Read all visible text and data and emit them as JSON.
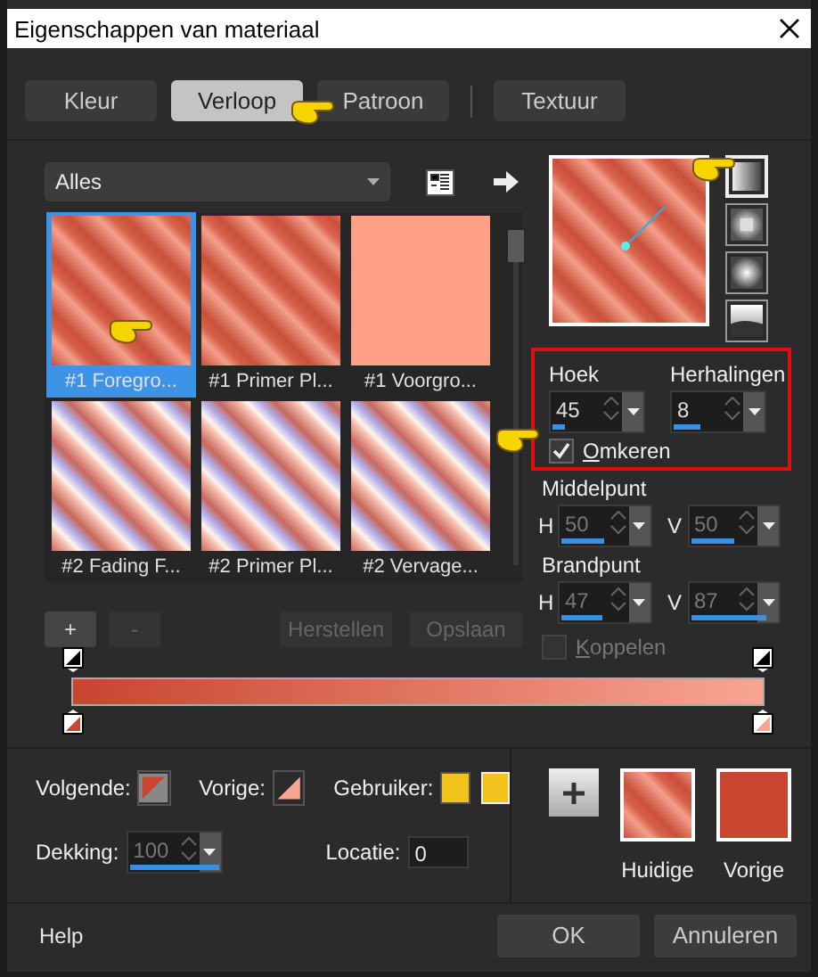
{
  "window": {
    "title": "Eigenschappen van materiaal"
  },
  "tabs": [
    {
      "label": "Kleur",
      "selected": false
    },
    {
      "label": "Verloop",
      "selected": true
    },
    {
      "label": "Patroon",
      "selected": false
    },
    {
      "label": "Textuur",
      "selected": false
    }
  ],
  "category": {
    "value": "Alles"
  },
  "gradients": [
    {
      "label": "#1 Foregro...",
      "selected": true,
      "kind": "stripes"
    },
    {
      "label": "#1 Primer Pl...",
      "selected": false,
      "kind": "stripes"
    },
    {
      "label": "#1 Voorgro...",
      "selected": false,
      "kind": "solid"
    },
    {
      "label": "#2 Fading F...",
      "selected": false,
      "kind": "checker"
    },
    {
      "label": "#2 Primer Pl...",
      "selected": false,
      "kind": "checker"
    },
    {
      "label": "#2 Vervage...",
      "selected": false,
      "kind": "checker"
    }
  ],
  "stop_buttons": [
    {
      "label": "+",
      "disabled": false
    },
    {
      "label": "-",
      "disabled": true
    }
  ],
  "preset_buttons": [
    {
      "label": "Herstellen",
      "disabled": true
    },
    {
      "label": "Opslaan",
      "disabled": true
    }
  ],
  "styles": [
    {
      "kind": "linear",
      "selected": true
    },
    {
      "kind": "rectangular",
      "selected": false
    },
    {
      "kind": "sunburst",
      "selected": false
    },
    {
      "kind": "radial",
      "selected": false
    }
  ],
  "angle": {
    "label": "Hoek",
    "value": "45",
    "level": 0.13
  },
  "repeats": {
    "label": "Herhalingen",
    "value": "8",
    "level": 0.3
  },
  "invert": {
    "label": "Omkeren",
    "checked": true
  },
  "center": {
    "label": "Middelpunt",
    "h": {
      "label": "H",
      "value": "50",
      "level": 0.5,
      "disabled": true
    },
    "v": {
      "label": "V",
      "value": "50",
      "level": 0.5,
      "disabled": true
    }
  },
  "focus": {
    "label": "Brandpunt",
    "h": {
      "label": "H",
      "value": "47",
      "level": 0.47,
      "disabled": true
    },
    "v": {
      "label": "V",
      "value": "87",
      "level": 0.87,
      "disabled": true
    }
  },
  "link": {
    "label": "Koppelen",
    "checked": false
  },
  "stops": [
    {
      "color": "#c8452f"
    },
    {
      "color": "#f8a593"
    }
  ],
  "next": {
    "label": "Volgende:",
    "color": "#c8452f"
  },
  "previous": {
    "label": "Vorige:",
    "color": "#f8a593"
  },
  "user": {
    "label": "Gebruiker:",
    "swatches": [
      {
        "color": "#f2c21c"
      },
      {
        "color": "#f2c21c"
      }
    ]
  },
  "opacity": {
    "label": "Dekking:",
    "value": "100",
    "level": 1,
    "disabled": true
  },
  "location": {
    "label": "Locatie:",
    "value": "0"
  },
  "current": {
    "label": "Huidige"
  },
  "previous_material": {
    "label": "Vorige",
    "color": "#c8452f"
  },
  "footer": {
    "help": "Help",
    "ok": "OK",
    "cancel": "Annuleren"
  }
}
